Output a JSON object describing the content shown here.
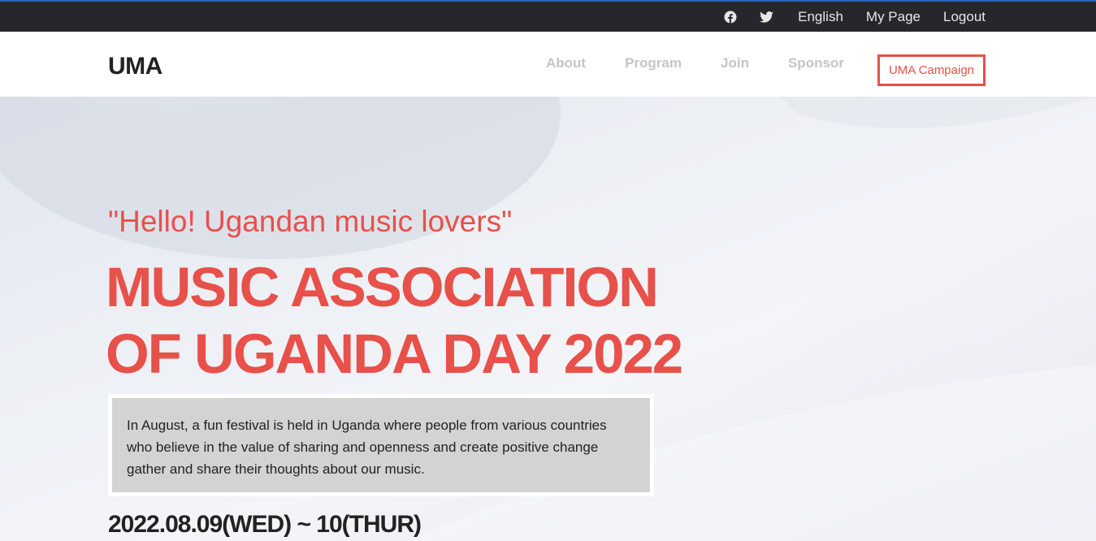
{
  "topbar": {
    "social": [
      "facebook-icon",
      "twitter-icon"
    ],
    "language": "English",
    "my_page": "My Page",
    "logout": "Logout"
  },
  "navbar": {
    "logo": "UMA",
    "items": [
      "About",
      "Program",
      "Join",
      "Sponsor"
    ],
    "campaign": "UMA Campaign"
  },
  "hero": {
    "tagline": "\"Hello! Ugandan music lovers\"",
    "headline_line1": "MUSIC ASSOCIATION",
    "headline_line2": "OF UGANDA DAY 2022",
    "intro": "In August, a fun festival is held in Uganda where people from various countries who believe in the value of sharing and openness and create positive change gather and share their thoughts about our music.",
    "date": "2022.08.09(WED) ~ 10(THUR)"
  },
  "colors": {
    "accent": "#e8504a",
    "topbar_bg": "#25272c",
    "nav_text": "#c5c5c5",
    "intro_bg": "#d3d3d3"
  }
}
